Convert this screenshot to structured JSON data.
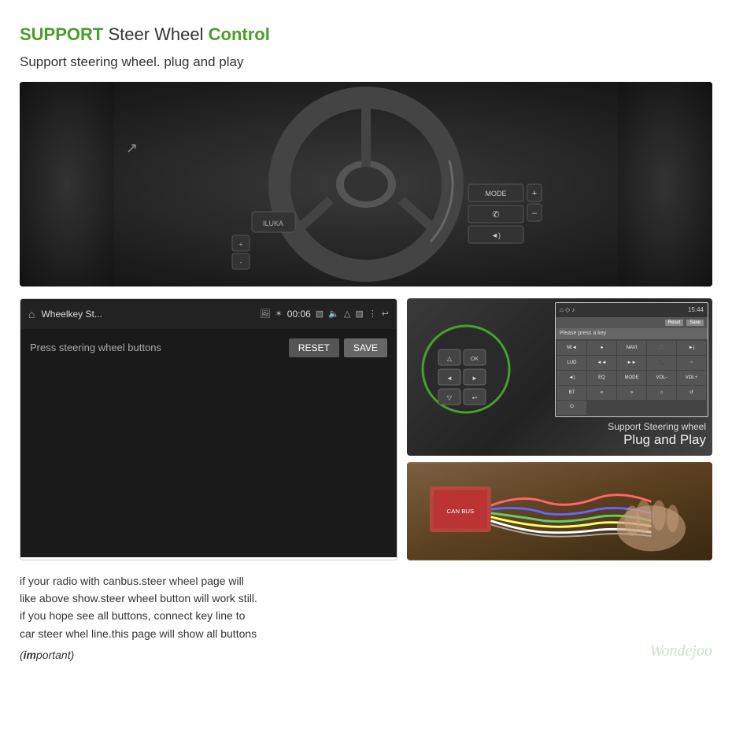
{
  "header": {
    "title_support": "SUPPORT",
    "title_steer_wheel": " Steer Wheel ",
    "title_control": "Control",
    "subtitle": "Support steering wheel. plug and play"
  },
  "app_panel": {
    "app_title": "Wheelkey St...",
    "app_time": "00:06",
    "press_text": "Press steering wheel buttons",
    "reset_btn": "RESET",
    "save_btn": "SAVE"
  },
  "interface_panel": {
    "header_icons": "⌂ ◇ ♪",
    "time": "15:44",
    "press_key_text": "Please press a key",
    "reset_label": "Reset",
    "save_label": "Save",
    "grid_cells": [
      "M/◄",
      "●",
      "NAVI",
      "🎵",
      "►|",
      "LUD",
      "◄◄",
      "►►",
      "📞",
      "~",
      "◄)",
      "EQ",
      "MODE",
      "VOL-",
      "VOL+",
      "BT",
      "«",
      "»",
      "⌂",
      "↺",
      "⏻"
    ]
  },
  "right_panel": {
    "support_sw_text": "Support Steering wheel",
    "plug_play_text": "Plug and Play"
  },
  "bottom_text": {
    "line1": "if your radio with canbus.steer wheel page will",
    "line2": "like above show.steer wheel button will work still.",
    "line3": "if you hope see all buttons, connect key line to",
    "line4": "car steer whel line.this page will show all buttons",
    "important": "(important)"
  },
  "logo": {
    "text": "Wondejoo"
  }
}
